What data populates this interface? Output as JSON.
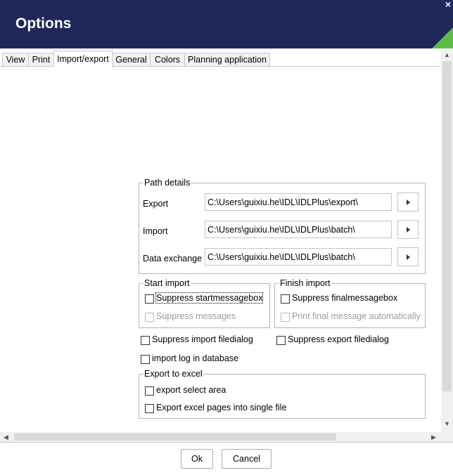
{
  "window": {
    "title": "Options",
    "close_symbol": "×"
  },
  "tabs": [
    {
      "label": "View"
    },
    {
      "label": "Print"
    },
    {
      "label": "Import/export",
      "active": true
    },
    {
      "label": "General"
    },
    {
      "label": "Colors"
    },
    {
      "label": "Planning application"
    }
  ],
  "path_details": {
    "legend": "Path details",
    "rows": [
      {
        "label": "Export",
        "value": "C:\\Users\\guixiu.he\\IDL\\IDLPlus\\export\\"
      },
      {
        "label": "Import",
        "value": "C:\\Users\\guixiu.he\\IDL\\IDLPlus\\batch\\"
      },
      {
        "label": "Data exchange",
        "value": "C:\\Users\\guixiu.he\\IDL\\IDLPlus\\batch\\"
      }
    ]
  },
  "start_import": {
    "legend": "Start import",
    "options": [
      {
        "label": "Suppress startmessagebox",
        "checked": false,
        "enabled": true
      },
      {
        "label": "Suppress messages",
        "checked": false,
        "enabled": false
      }
    ]
  },
  "finish_import": {
    "legend": "Finish import",
    "options": [
      {
        "label": "Suppress finalmessagebox",
        "checked": false,
        "enabled": true
      },
      {
        "label": "Print final message automatically",
        "checked": false,
        "enabled": false
      }
    ]
  },
  "checkboxes": {
    "suppress_import_filedialog": "Suppress import filedialog",
    "suppress_export_filedialog": "Suppress export filedialog",
    "import_log": "import log in database"
  },
  "export_to_excel": {
    "legend": "Export to excel",
    "options": [
      {
        "label": "export select area",
        "checked": false
      },
      {
        "label": "Export excel pages into single file",
        "checked": false
      }
    ]
  },
  "buttons": {
    "ok": "Ok",
    "cancel": "Cancel"
  },
  "colors": {
    "titlebar": "#20285a",
    "accent": "#5fba45"
  }
}
